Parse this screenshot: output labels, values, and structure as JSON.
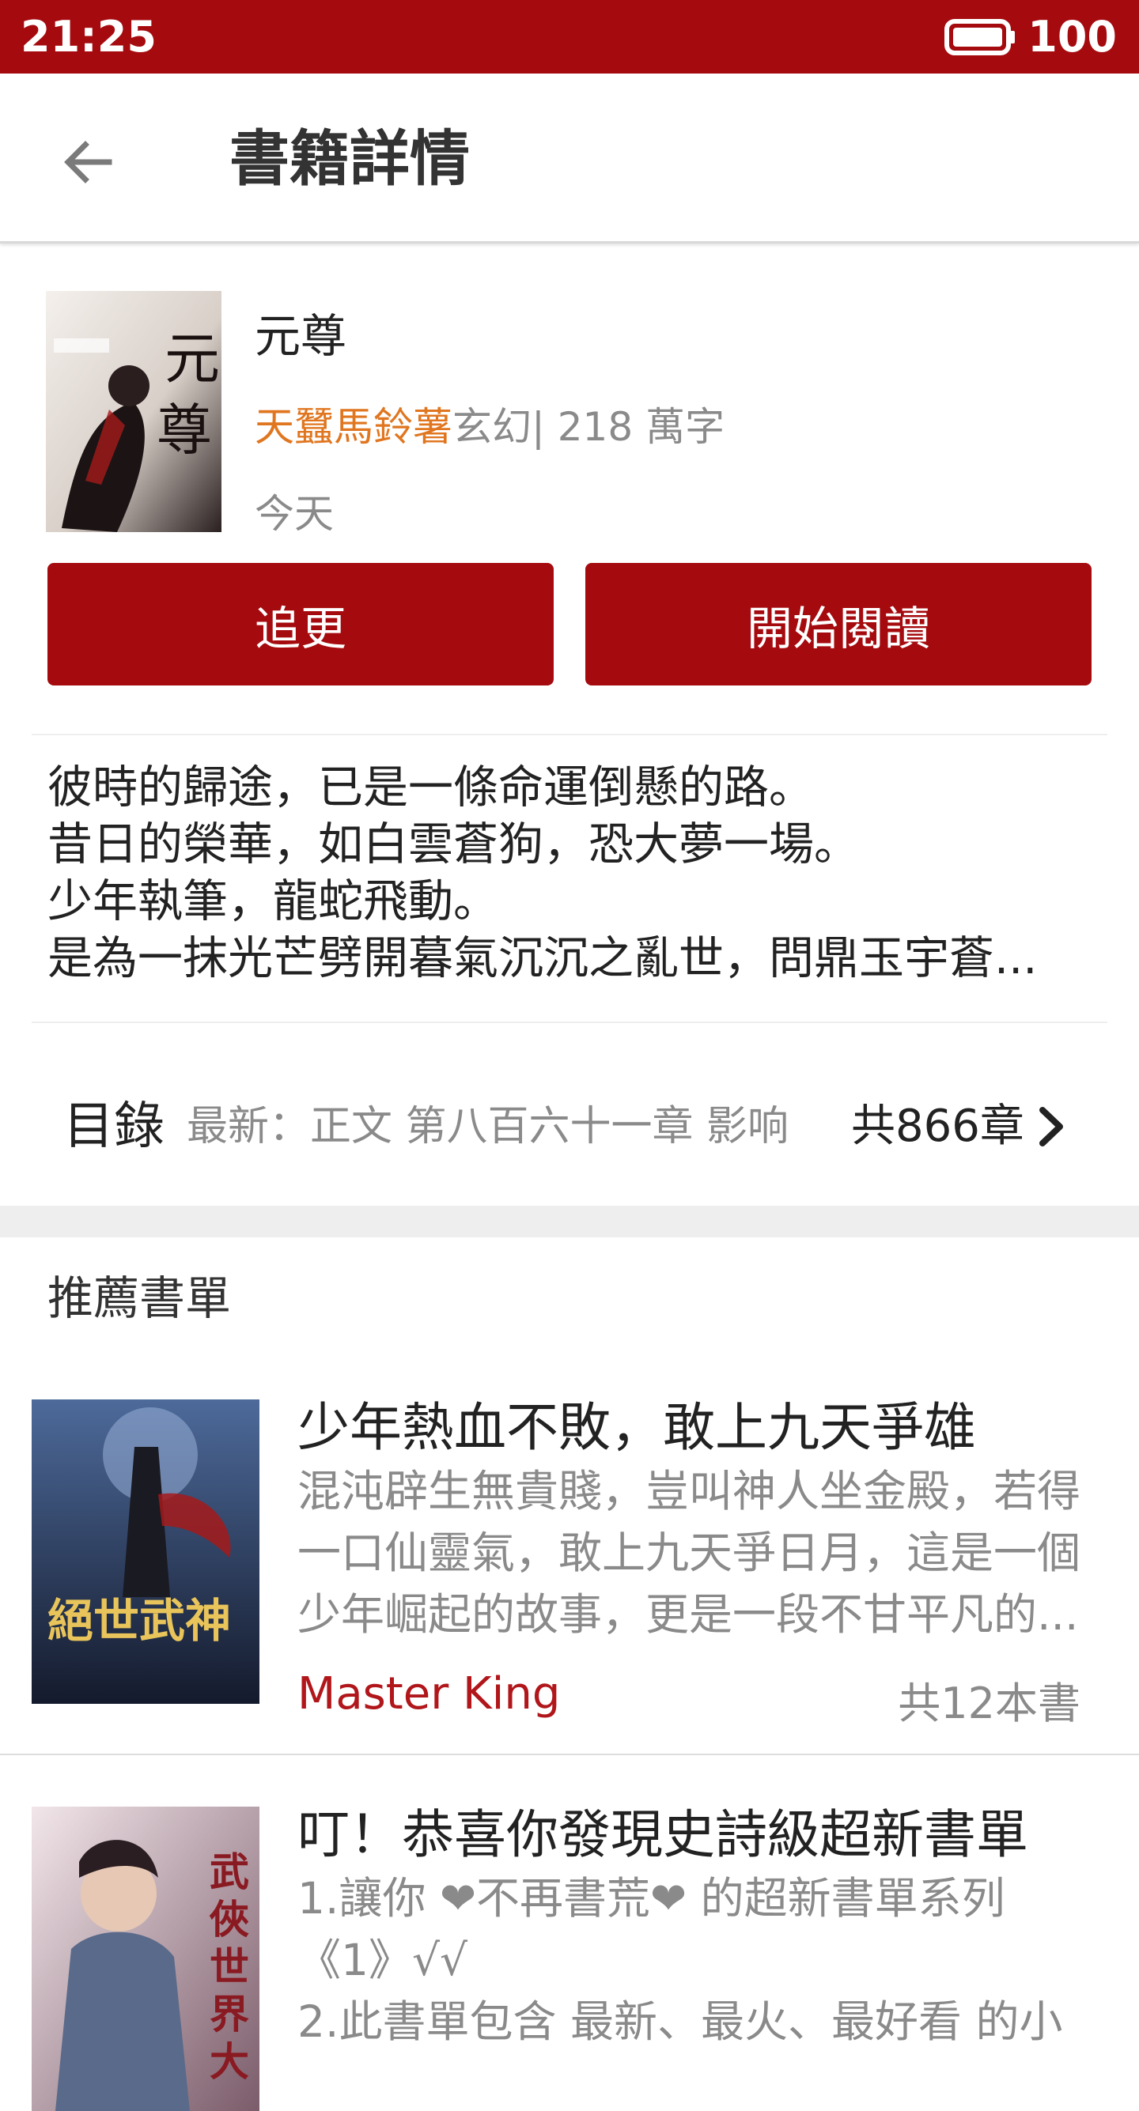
{
  "status_bar": {
    "time": "21:25",
    "battery": "100"
  },
  "app_bar": {
    "title": "書籍詳情"
  },
  "book": {
    "title": "元尊",
    "author": "天蠶馬鈴薯",
    "category_words": "玄幻| 218 萬字",
    "updated": "今天",
    "cover_text": "元尊",
    "follow_label": "追更",
    "read_label": "開始閱讀",
    "synopsis": [
      "彼時的歸途，已是一條命運倒懸的路。",
      "昔日的榮華，如白雲蒼狗，恐大夢一場。",
      "少年執筆，龍蛇飛動。",
      "是為一抹光芒劈開暮氣沉沉之亂世，問鼎玉宇蒼..."
    ]
  },
  "toc": {
    "label": "目錄",
    "latest": "最新：正文 第八百六十一章  影响",
    "count": "共866章"
  },
  "recommend": {
    "heading": "推薦書單",
    "items": [
      {
        "title": "少年熱血不敗，敢上九天爭雄",
        "desc": [
          " 混沌辟生無貴賤，豈叫神人坐金殿，若得",
          "一口仙靈氣，敢上九天爭日月，這是一個",
          "少年崛起的故事，更是一段不甘平凡的..."
        ],
        "author": "Master King",
        "count": "共12本書",
        "cover_text": "絕世武神",
        "colors": [
          "#1d2a4a",
          "#4d6a9a"
        ]
      },
      {
        "title": "叮！恭喜你發現史詩級超新書單",
        "desc": [
          "1.讓你 ❤不再書荒❤ 的超新書單系列",
          "《1》√√",
          "2.此書單包含  最新、最火、最好看 的小"
        ],
        "author": "",
        "count": "",
        "cover_text": "武俠世界大",
        "colors": [
          "#e8dce0",
          "#7b5c6a"
        ]
      }
    ]
  },
  "colors": {
    "brand": "#a50a0e",
    "author_orange": "#e0761f",
    "list_author_red": "#b0161a"
  }
}
